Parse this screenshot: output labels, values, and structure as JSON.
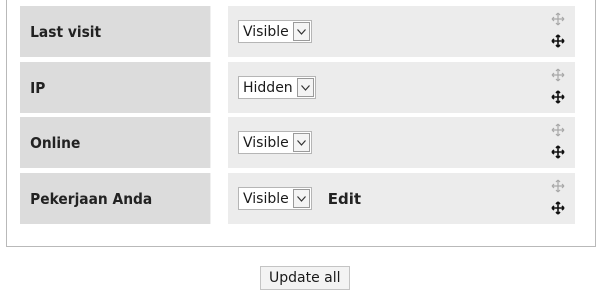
{
  "rows": [
    {
      "label": "Last visit",
      "visibility": "Visible"
    },
    {
      "label": "IP",
      "visibility": "Hidden"
    },
    {
      "label": "Online",
      "visibility": "Visible"
    },
    {
      "label": "Pekerjaan Anda",
      "visibility": "Visible",
      "edit_label": "Edit"
    }
  ],
  "dropdown_arrow_icon": "chevron-down-icon",
  "move_icon": "move-icon",
  "update_all_label": "Update all",
  "colors": {
    "label_bg": "#dcdcdc",
    "value_bg": "#ececec",
    "panel_border": "#b9b9b9"
  }
}
